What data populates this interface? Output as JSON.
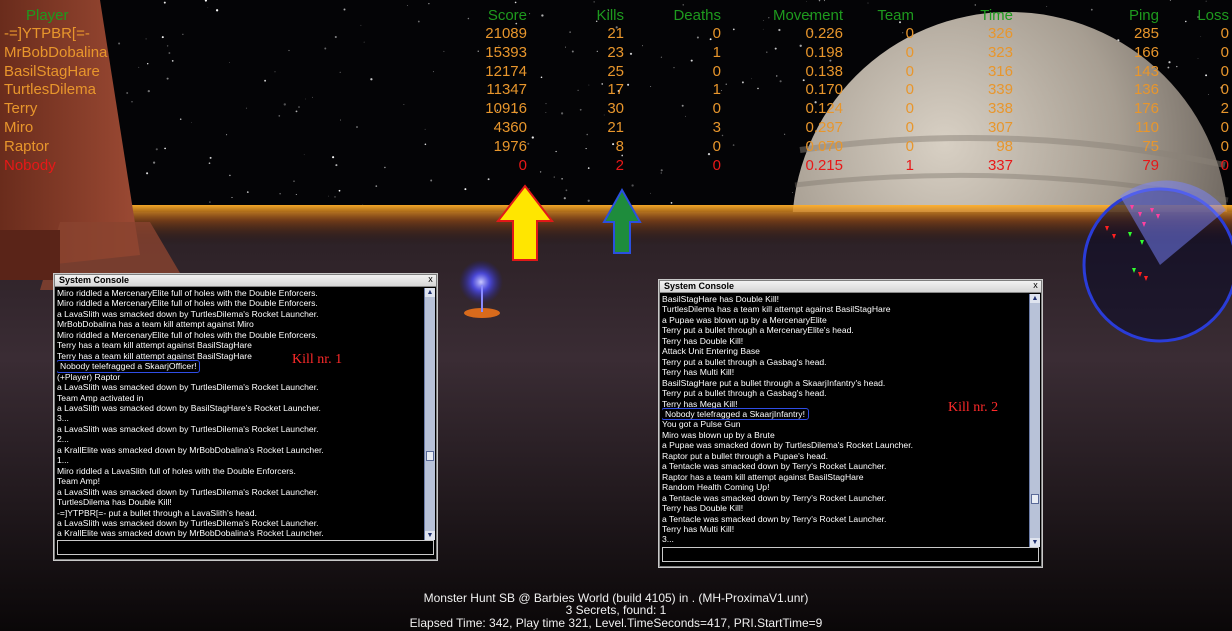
{
  "scoreboard": {
    "headers": {
      "player": "Player",
      "score": "Score",
      "kills": "Kills",
      "deaths": "Deaths",
      "movement": "Movement",
      "team": "Team",
      "time": "Time",
      "ping": "Ping",
      "loss": "Loss"
    },
    "header_color": "#1e9a1e",
    "rows": [
      {
        "player": "-=]YTPBR[=-",
        "score": "21089",
        "kills": "21",
        "deaths": "0",
        "movement": "0.226",
        "team": "0",
        "time": "326",
        "ping": "285",
        "loss": "0",
        "color": "#e8962c"
      },
      {
        "player": "MrBobDobalina",
        "score": "15393",
        "kills": "23",
        "deaths": "1",
        "movement": "0.198",
        "team": "0",
        "time": "323",
        "ping": "166",
        "loss": "0",
        "color": "#e8962c"
      },
      {
        "player": "BasilStagHare",
        "score": "12174",
        "kills": "25",
        "deaths": "0",
        "movement": "0.138",
        "team": "0",
        "time": "316",
        "ping": "143",
        "loss": "0",
        "color": "#e8962c"
      },
      {
        "player": "TurtlesDilema",
        "score": "11347",
        "kills": "17",
        "deaths": "1",
        "movement": "0.170",
        "team": "0",
        "time": "339",
        "ping": "136",
        "loss": "0",
        "color": "#e8962c"
      },
      {
        "player": "Terry",
        "score": "10916",
        "kills": "30",
        "deaths": "0",
        "movement": "0.124",
        "team": "0",
        "time": "338",
        "ping": "176",
        "loss": "2",
        "color": "#e8962c"
      },
      {
        "player": "Miro",
        "score": "4360",
        "kills": "21",
        "deaths": "3",
        "movement": "0.297",
        "team": "0",
        "time": "307",
        "ping": "110",
        "loss": "0",
        "color": "#e8962c"
      },
      {
        "player": "Raptor",
        "score": "1976",
        "kills": "8",
        "deaths": "0",
        "movement": "0.070",
        "team": "0",
        "time": "98",
        "ping": "75",
        "loss": "0",
        "color": "#e8962c"
      },
      {
        "player": "Nobody",
        "score": "0",
        "kills": "2",
        "deaths": "0",
        "movement": "0.215",
        "team": "1",
        "time": "337",
        "ping": "79",
        "loss": "0",
        "color": "#e81818"
      }
    ]
  },
  "arrows": {
    "score_arrow_color": "#ffe600",
    "kills_arrow_color": "#1e8c3c",
    "outline_color": "#e01818"
  },
  "console_left": {
    "title": "System Console",
    "close": "x",
    "lines": [
      "Miro riddled a MercenaryElite full of holes with the Double Enforcers.",
      "Miro riddled a MercenaryElite full of holes with the Double Enforcers.",
      "a LavaSlith was smacked down by TurtlesDilema's Rocket Launcher.",
      "MrBobDobalina has a team kill attempt against Miro",
      "Miro riddled a MercenaryElite full of holes with the Double Enforcers.",
      "Terry has a team kill attempt against BasilStagHare",
      "Terry has a team kill attempt against BasilStagHare",
      "Nobody telefragged a SkaarjOfficer!",
      "(+Player) Raptor",
      "a LavaSlith was smacked down by TurtlesDilema's Rocket Launcher.",
      "",
      "a LavaSlith was smacked down by BasilStagHare's Rocket Launcher.",
      "3...",
      "a LavaSlith was smacked down by TurtlesDilema's Rocket Launcher.",
      "2...",
      "a KrallElite was smacked down by MrBobDobalina's Rocket Launcher.",
      "1...",
      "Miro riddled a LavaSlith full of holes with the Double Enforcers.",
      "Team Amp!",
      "a LavaSlith was smacked down by TurtlesDilema's Rocket Launcher.",
      "TurtlesDilema has Double Kill!",
      "-=]YTPBR[=- put a bullet through a LavaSlith's head.",
      "a LavaSlith was smacked down by TurtlesDilema's Rocket Launcher.",
      "a KrallElite was smacked down by MrBobDobalina's Rocket Launcher."
    ],
    "extra_line": "Team Amp activated in",
    "highlight_index": 7,
    "kill_label": "Kill  nr. 1"
  },
  "console_right": {
    "title": "System Console",
    "close": "x",
    "lines": [
      "BasilStagHare has Double Kill!",
      "TurtlesDilema has a team kill attempt against BasilStagHare",
      "a Pupae was blown up by a MercenaryElite",
      "Terry put a bullet through a MercenaryElite's head.",
      "Terry has Double Kill!",
      "Attack Unit Entering Base",
      "Terry put a bullet through a Gasbag's head.",
      "Terry has Multi Kill!",
      "BasilStagHare put a bullet through a SkaarjInfantry's head.",
      "Terry put a bullet through a Gasbag's head.",
      "Terry has Mega Kill!",
      "Nobody telefragged a SkaarjInfantry!",
      "You got a Pulse Gun",
      "Miro was blown up by a Brute",
      "a Pupae was smacked down by TurtlesDilema's Rocket Launcher.",
      "Raptor put a bullet through a Pupae's head.",
      "a Tentacle was smacked down by Terry's Rocket Launcher.",
      "Raptor has a team kill attempt against BasilStagHare",
      "Random Health Coming Up!",
      "a Tentacle was smacked down by Terry's Rocket Launcher.",
      "Terry has Double Kill!",
      "a Tentacle was smacked down by Terry's Rocket Launcher.",
      "Terry has Multi Kill!",
      "3..."
    ],
    "highlight_index": 11,
    "kill_label": "Kill  nr. 2"
  },
  "server_info": {
    "line1": "Monster Hunt SB @ Barbies World (build 4105) in . (MH-ProximaV1.unr)",
    "line2": "3 Secrets, found: 1",
    "line3": "Elapsed Time:  342, Play time 321, Level.TimeSeconds=417, PRI.StartTime=9"
  },
  "radar": {
    "ring_color": "#2a3cd8"
  }
}
